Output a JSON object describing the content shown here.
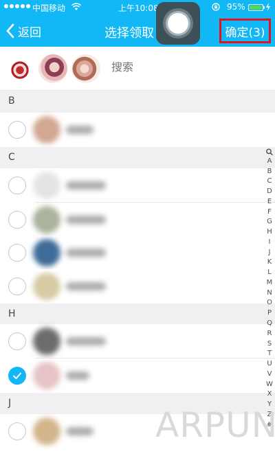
{
  "status_bar": {
    "carrier": "中国移动",
    "time": "上午10:08",
    "battery_percent": "95%",
    "battery_level": 0.95,
    "icons": [
      "signal-dots-icon",
      "wifi-icon",
      "orientation-lock-icon",
      "battery-icon",
      "charging-bolt-icon"
    ]
  },
  "nav": {
    "back_label": "返回",
    "title": "选择领取",
    "confirm_label": "确定(3)"
  },
  "search": {
    "placeholder": "搜索"
  },
  "sections": [
    {
      "letter": "B"
    },
    {
      "letter": "C"
    },
    {
      "letter": "H"
    },
    {
      "letter": "J"
    }
  ],
  "rows": [
    {
      "checked": false
    },
    {
      "checked": false
    },
    {
      "checked": false
    },
    {
      "checked": false
    },
    {
      "checked": false
    },
    {
      "checked": false
    },
    {
      "checked": true
    },
    {
      "checked": false
    }
  ],
  "alphabet_index": [
    "A",
    "B",
    "C",
    "D",
    "E",
    "F",
    "G",
    "H",
    "I",
    "J",
    "K",
    "L",
    "M",
    "N",
    "O",
    "P",
    "Q",
    "R",
    "S",
    "T",
    "U",
    "V",
    "W",
    "X",
    "Y",
    "Z",
    "#"
  ],
  "watermark": "ARPUN.COM",
  "colors": {
    "header_blue": "#12b7f5",
    "confirm_highlight_border": "#e8101b",
    "checked_blue": "#12b7f5"
  }
}
